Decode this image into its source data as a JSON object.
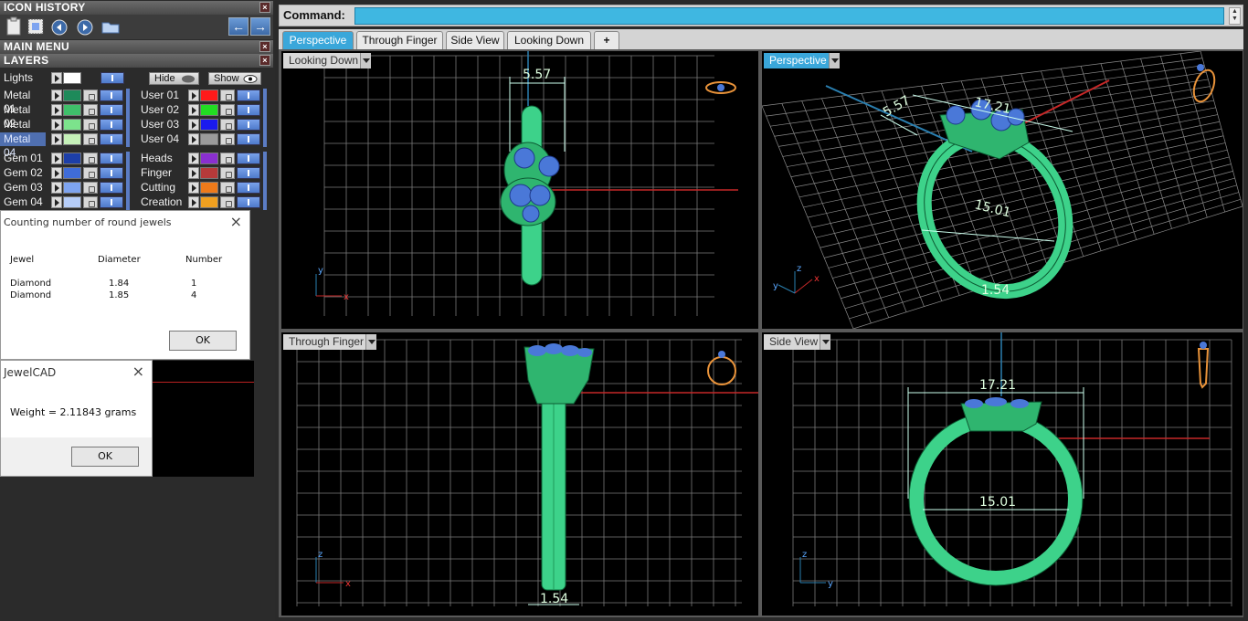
{
  "left_panel": {
    "icon_history_title": "ICON HISTORY",
    "main_menu_title": "MAIN MENU",
    "layers_title": "LAYERS",
    "close_glyph": "×",
    "lights_label": "Lights",
    "hide_label": "Hide",
    "show_label": "Show",
    "metal_layers": [
      {
        "label": "Metal 01",
        "color": "#1e8a5a"
      },
      {
        "label": "Metal 02",
        "color": "#3fbf6a"
      },
      {
        "label": "Metal 03",
        "color": "#7ce38c"
      },
      {
        "label": "Metal 04",
        "color": "#c5f0b8"
      }
    ],
    "user_layers": [
      {
        "label": "User 01",
        "color": "#ff1a1a"
      },
      {
        "label": "User 02",
        "color": "#22dd22"
      },
      {
        "label": "User 03",
        "color": "#1a1aee"
      },
      {
        "label": "User 04",
        "color": "#9b9b9b"
      }
    ],
    "gem_layers": [
      {
        "label": "Gem 01",
        "color": "#1d3fa8"
      },
      {
        "label": "Gem 02",
        "color": "#3f6cd8"
      },
      {
        "label": "Gem 03",
        "color": "#7ea4f0"
      },
      {
        "label": "Gem 04",
        "color": "#b6cdf8"
      }
    ],
    "other_layers": [
      {
        "label": "Heads",
        "color": "#8a2fd0"
      },
      {
        "label": "Finger",
        "color": "#b63a3a"
      },
      {
        "label": "Cutting",
        "color": "#ee7a1a"
      },
      {
        "label": "Creation",
        "color": "#f0a020"
      }
    ]
  },
  "jewels_dialog": {
    "title": "Counting number of round jewels",
    "headers": [
      "Jewel",
      "Diameter",
      "Number"
    ],
    "rows": [
      [
        "Diamond",
        "1.84",
        "1"
      ],
      [
        "Diamond",
        "1.85",
        "4"
      ]
    ],
    "ok": "OK"
  },
  "weight_dialog": {
    "title": "JewelCAD",
    "message": "Weight = 2.11843 grams",
    "ok": "OK"
  },
  "command": {
    "label": "Command:"
  },
  "tabs": [
    "Perspective",
    "Through Finger",
    "Side View",
    "Looking Down"
  ],
  "add_tab_glyph": "+",
  "viewports": {
    "looking_down": {
      "title": "Looking Down",
      "dim_width": "5.57"
    },
    "perspective": {
      "title": "Perspective",
      "dim_top": "17.21",
      "dim_side": "5.57",
      "dim_inner": "15.01",
      "dim_small": "1.54"
    },
    "through_finger": {
      "title": "Through Finger",
      "dim_bottom": "1.54"
    },
    "side_view": {
      "title": "Side View",
      "dim_top": "17.21",
      "dim_inner": "15.01"
    }
  },
  "axes": {
    "x": "x",
    "y": "y",
    "z": "z"
  },
  "colors": {
    "accent_blue": "#3aa7da",
    "ring_green": "#3dd28a",
    "gem_blue": "#4a78d8",
    "grid": "#8a8a8a",
    "axis_red": "#c62828",
    "axis_blue": "#2a7fb0"
  }
}
